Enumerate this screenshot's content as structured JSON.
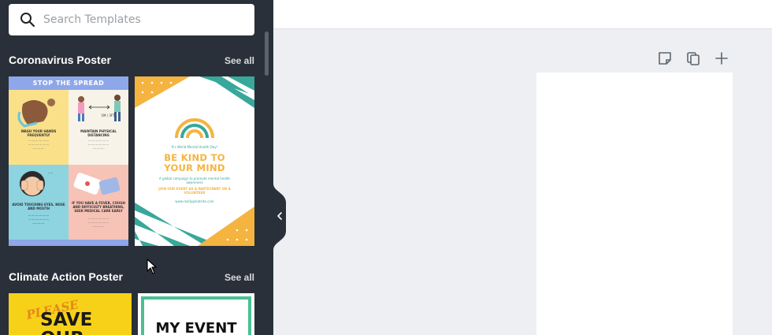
{
  "search": {
    "placeholder": "Search Templates"
  },
  "sections": [
    {
      "title": "Coronavirus Poster",
      "see_all": "See all"
    },
    {
      "title": "Climate Action Poster",
      "see_all": "See all"
    }
  ],
  "templates": {
    "stop_spread": {
      "header": "STOP THE SPREAD",
      "captions": [
        "WASH YOUR HANDS FREQUENTLY",
        "MAINTAIN PHYSICAL DISTANCING",
        "AVOID TOUCHING EYES, NOSE AND MOUTH",
        "IF YOU HAVE A FEVER, COUGH AND DIFFICULTY BREATHING, SEEK MEDICAL CARE EARLY"
      ],
      "distance": "1M / 3FT"
    },
    "be_kind": {
      "top_line": "It's World Mental Health Day!",
      "headline_1": "BE KIND TO",
      "headline_2": "YOUR MIND",
      "sub_1": "A global campaign to promote mental health awareness",
      "sub_2": "JOIN OUR EVENT AS A PARTICIPANT OR A VOLUNTEER",
      "url": "www.reallygreatsite.com"
    },
    "save_our": {
      "script": "PLEASE",
      "headline": "SAVE OUR"
    },
    "my_event": {
      "headline": "MY EVENT"
    }
  },
  "colors": {
    "sidebar_bg": "#293039",
    "teal": "#37a89a",
    "amber": "#f5b43f",
    "blue": "#8da7e8"
  },
  "icons": {
    "search": "search-icon",
    "collapse": "chevron-left-icon",
    "note": "sticky-note-icon",
    "duplicate": "duplicate-page-icon",
    "add": "add-page-icon"
  }
}
